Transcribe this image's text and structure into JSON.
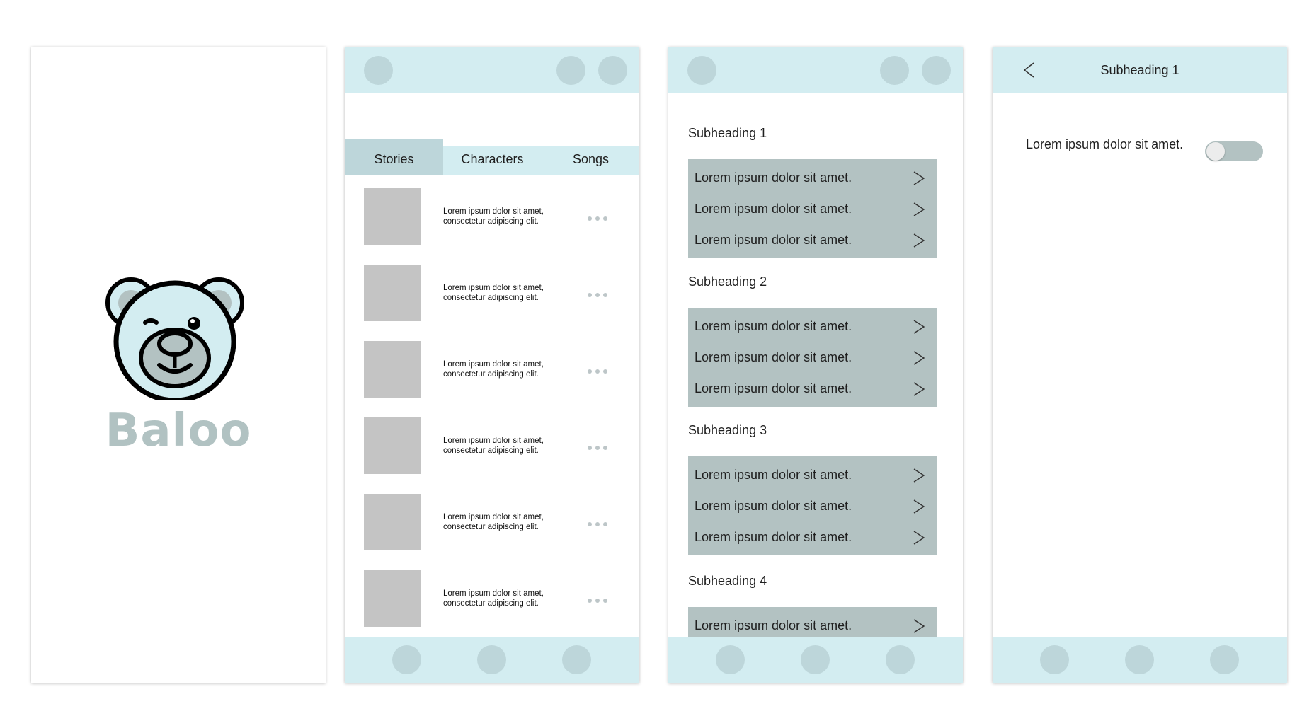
{
  "colors": {
    "bar_background": "#d3edf1",
    "icon_placeholder": "#bdd6da",
    "card_background": "#b3c2c2",
    "thumbnail": "#c4c4c4",
    "brand_text": "#b1c2c2",
    "bear_face": "#d3edf1"
  },
  "splash": {
    "brand": "Baloo",
    "logo_icon": "bear-face-icon"
  },
  "stories_screen": {
    "tabs": [
      {
        "label": "Stories",
        "active": true
      },
      {
        "label": "Characters",
        "active": false
      },
      {
        "label": "Songs",
        "active": false
      }
    ],
    "rows": [
      {
        "line1": "Lorem ipsum dolor sit amet,",
        "line2": "consectetur adipiscing elit."
      },
      {
        "line1": "Lorem ipsum dolor sit amet,",
        "line2": "consectetur adipiscing elit."
      },
      {
        "line1": "Lorem ipsum dolor sit amet,",
        "line2": "consectetur adipiscing elit."
      },
      {
        "line1": "Lorem ipsum dolor sit amet,",
        "line2": "consectetur adipiscing elit."
      },
      {
        "line1": "Lorem ipsum dolor sit amet,",
        "line2": "consectetur adipiscing elit."
      },
      {
        "line1": "Lorem ipsum dolor sit amet,",
        "line2": "consectetur adipiscing elit."
      }
    ]
  },
  "settings_screen": {
    "sections": [
      {
        "heading": "Subheading 1",
        "items": [
          "Lorem ipsum dolor sit amet.",
          "Lorem ipsum dolor sit amet.",
          "Lorem ipsum dolor sit amet."
        ]
      },
      {
        "heading": "Subheading 2",
        "items": [
          "Lorem ipsum dolor sit amet.",
          "Lorem ipsum dolor sit amet.",
          "Lorem ipsum dolor sit amet."
        ]
      },
      {
        "heading": "Subheading 3",
        "items": [
          "Lorem ipsum dolor sit amet.",
          "Lorem ipsum dolor sit amet.",
          "Lorem ipsum dolor sit amet."
        ]
      },
      {
        "heading": "Subheading 4",
        "items": [
          "Lorem ipsum dolor sit amet."
        ]
      }
    ]
  },
  "detail_screen": {
    "title": "Subheading 1",
    "row_label": "Lorem ipsum dolor sit amet.",
    "toggle_on": false
  }
}
